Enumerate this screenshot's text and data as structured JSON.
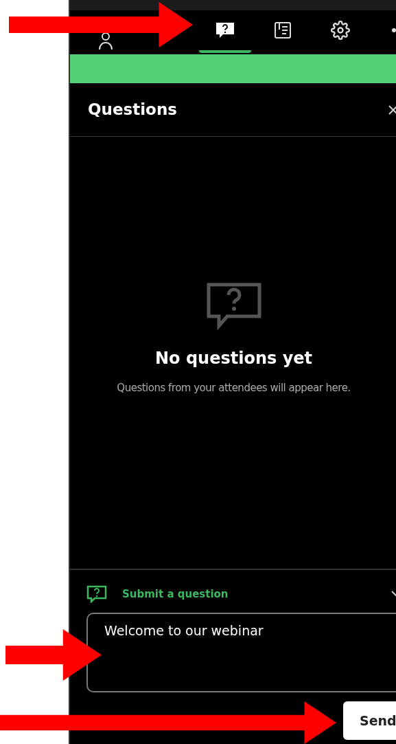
{
  "tabs": [
    {
      "kind": "people",
      "selected": false
    },
    {
      "kind": "question",
      "selected": true
    },
    {
      "kind": "notes",
      "selected": false
    },
    {
      "kind": "settings",
      "selected": false
    },
    {
      "kind": "more",
      "selected": false
    }
  ],
  "panel": {
    "title": "Questions"
  },
  "empty_state": {
    "heading": "No questions yet",
    "message": "Questions from your attendees will appear here."
  },
  "submit": {
    "label": "Submit a question",
    "expanded": true,
    "value": "Welcome to our webinar",
    "button": "Send"
  }
}
